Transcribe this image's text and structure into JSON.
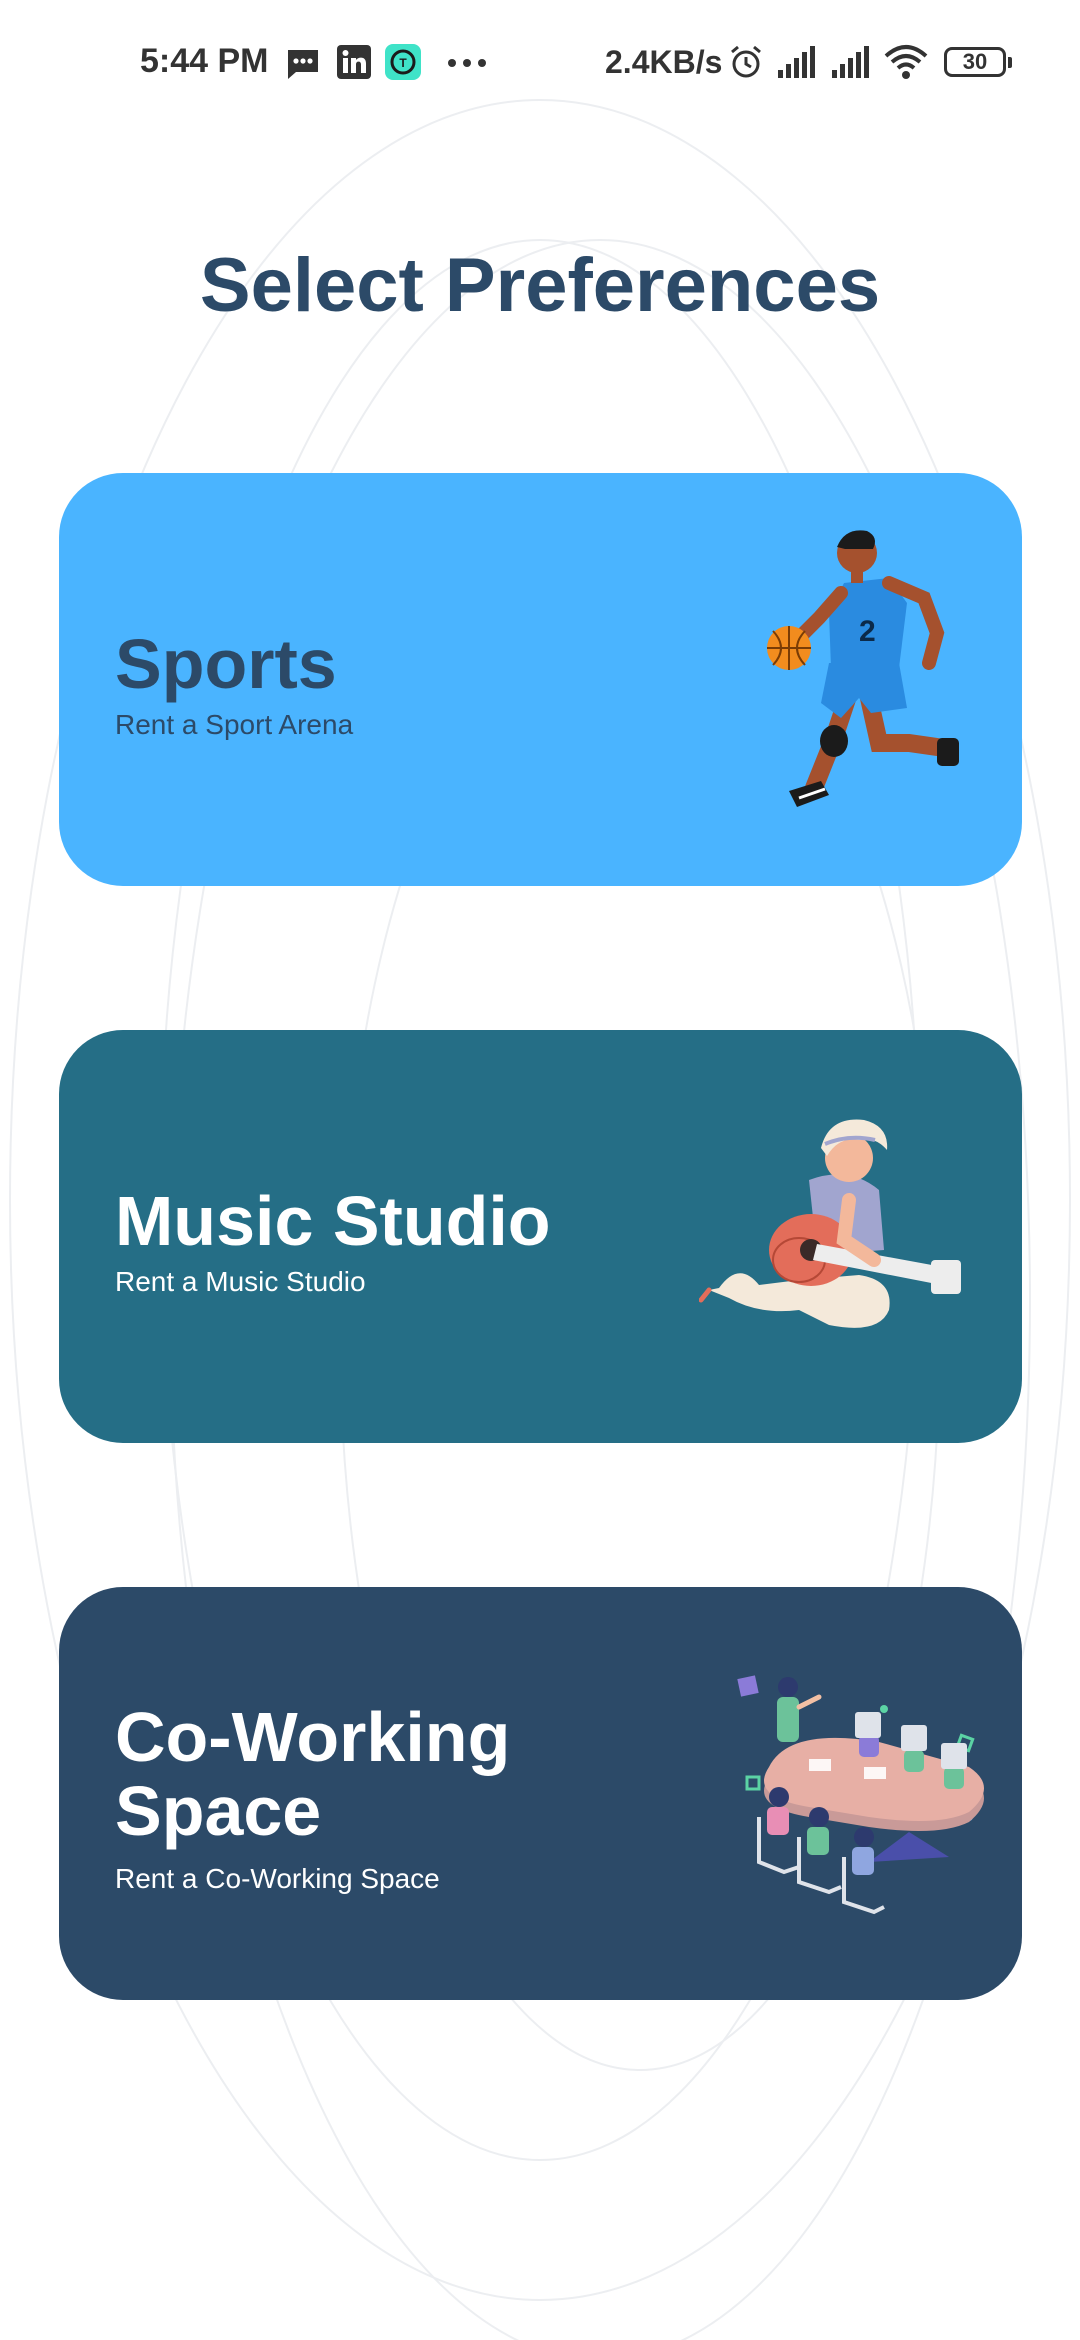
{
  "status_bar": {
    "time": "5:44 PM",
    "network_speed": "2.4KB/s",
    "battery": "30",
    "icons": [
      "message-icon",
      "linkedin-icon",
      "app-icon",
      "more-icon",
      "alarm-icon",
      "signal-icon",
      "signal-icon-2",
      "wifi-icon",
      "battery-icon"
    ]
  },
  "page": {
    "title": "Select Preferences"
  },
  "cards": [
    {
      "id": "sports",
      "title": "Sports",
      "subtitle": "Rent a Sport Arena",
      "background": "#4AB4FF",
      "title_color": "#2C4A68",
      "subtitle_color": "#2C4A68",
      "illustration": "basketball-player-illustration"
    },
    {
      "id": "music-studio",
      "title": "Music Studio",
      "subtitle": "Rent a Music Studio",
      "background": "#256E86",
      "title_color": "#FFFFFF",
      "subtitle_color": "#FFFFFF",
      "illustration": "guitar-player-illustration"
    },
    {
      "id": "co-working",
      "title": "Co-Working Space",
      "subtitle": "Rent a Co-Working Space",
      "background": "#2C4A68",
      "title_color": "#FFFFFF",
      "subtitle_color": "#FFFFFF",
      "illustration": "meeting-table-illustration"
    }
  ]
}
